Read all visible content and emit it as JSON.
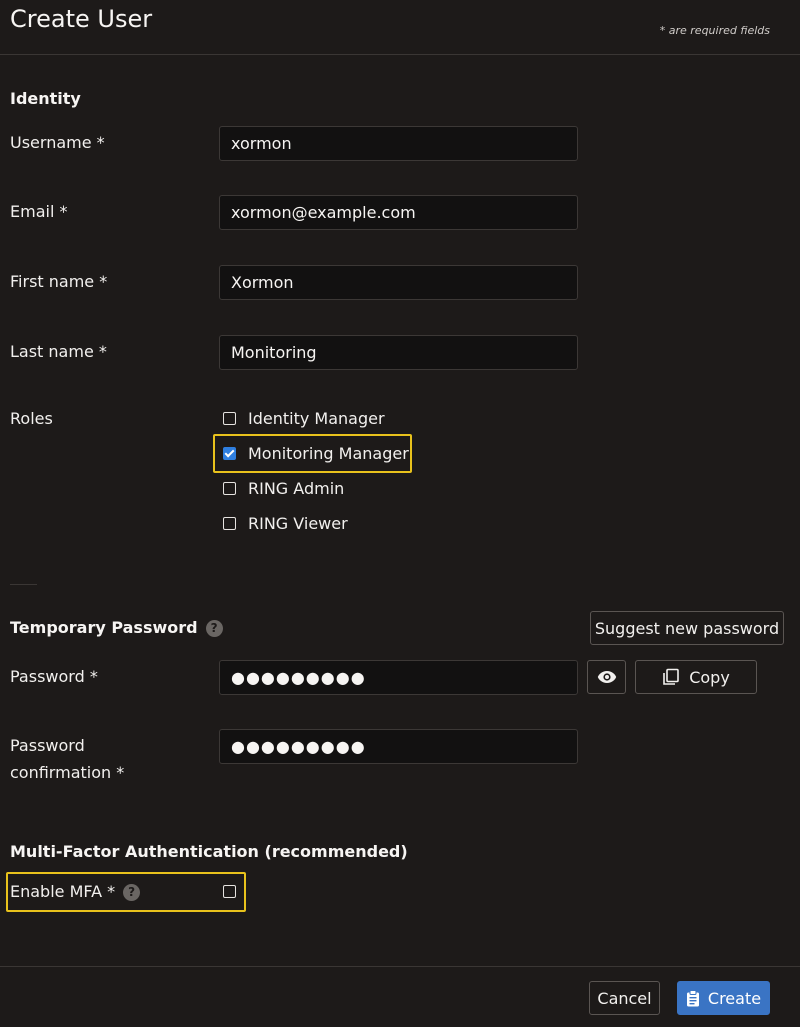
{
  "header": {
    "title": "Create User",
    "required_note": "* are required fields"
  },
  "identity": {
    "section_title": "Identity",
    "username": {
      "label": "Username *",
      "value": "xormon"
    },
    "email": {
      "label": "Email *",
      "value": "xormon@example.com"
    },
    "first_name": {
      "label": "First name *",
      "value": "Xormon"
    },
    "last_name": {
      "label": "Last name *",
      "value": "Monitoring"
    },
    "roles": {
      "label": "Roles",
      "options": [
        {
          "label": "Identity Manager",
          "checked": false
        },
        {
          "label": "Monitoring Manager",
          "checked": true
        },
        {
          "label": "RING Admin",
          "checked": false
        },
        {
          "label": "RING Viewer",
          "checked": false
        }
      ]
    }
  },
  "temporary_password": {
    "section_title": "Temporary Password",
    "help_icon": "question-circle-icon",
    "suggest_button": "Suggest new password",
    "password": {
      "label": "Password *",
      "value": "●●●●●●●●●"
    },
    "show_icon": "eye-icon",
    "copy_icon": "copy-icon",
    "copy_button": "Copy",
    "confirmation": {
      "label_line1": "Password",
      "label_line2": "confirmation *",
      "value": "●●●●●●●●●"
    }
  },
  "mfa": {
    "section_title": "Multi-Factor Authentication (recommended)",
    "enable_label": "Enable MFA *",
    "help_icon": "question-circle-icon",
    "enabled": false
  },
  "footer": {
    "cancel_button": "Cancel",
    "create_button": "Create",
    "create_icon": "clipboard-icon"
  },
  "colors": {
    "background": "#1d1a19",
    "input_background": "#121111",
    "primary": "#3a74c4",
    "highlight": "#e8c21c",
    "checkbox_checked": "#2f7fe0"
  }
}
